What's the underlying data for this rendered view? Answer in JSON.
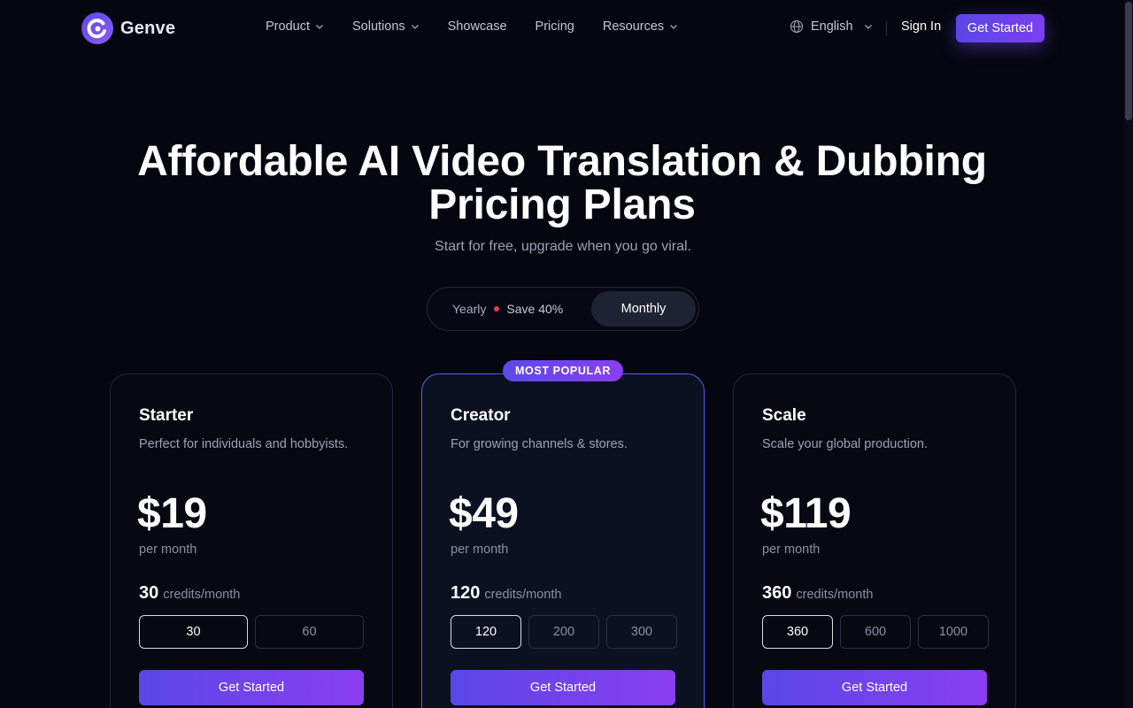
{
  "header": {
    "brand": "Genve",
    "nav": [
      {
        "label": "Product",
        "has_dropdown": true
      },
      {
        "label": "Solutions",
        "has_dropdown": true
      },
      {
        "label": "Showcase",
        "has_dropdown": false
      },
      {
        "label": "Pricing",
        "has_dropdown": false
      },
      {
        "label": "Resources",
        "has_dropdown": true
      }
    ],
    "language": "English",
    "sign_in": "Sign In",
    "cta": "Get Started"
  },
  "hero": {
    "title_line1": "Affordable AI Video Translation & Dubbing",
    "title_line2": "Pricing Plans",
    "subtitle": "Start for free, upgrade when you go viral."
  },
  "billing": {
    "yearly_label": "Yearly",
    "save_label": "Save 40%",
    "monthly_label": "Monthly",
    "selected": "Monthly"
  },
  "plans": [
    {
      "name": "Starter",
      "description": "Perfect for individuals and hobbyists.",
      "price": "$19",
      "period": "per month",
      "credits": "30",
      "credits_unit": "credits/month",
      "options": [
        "30",
        "60"
      ],
      "selected_option": "30",
      "cta": "Get Started"
    },
    {
      "name": "Creator",
      "badge": "MOST POPULAR",
      "description": "For growing channels & stores.",
      "price": "$49",
      "period": "per month",
      "credits": "120",
      "credits_unit": "credits/month",
      "options": [
        "120",
        "200",
        "300"
      ],
      "selected_option": "120",
      "cta": "Get Started"
    },
    {
      "name": "Scale",
      "description": "Scale your global production.",
      "price": "$119",
      "period": "per month",
      "credits": "360",
      "credits_unit": "credits/month",
      "options": [
        "360",
        "600",
        "1000"
      ],
      "selected_option": "360",
      "cta": "Get Started"
    }
  ],
  "colors": {
    "background": "#05060f",
    "accent_start": "#5a47e8",
    "accent_end": "#8a3ef0",
    "featured_border": "#5560e8",
    "save_dot": "#e23b4f"
  },
  "icons": {
    "logo": "genve-logo-icon",
    "dropdown": "chevron-down-icon",
    "language": "globe-icon"
  }
}
